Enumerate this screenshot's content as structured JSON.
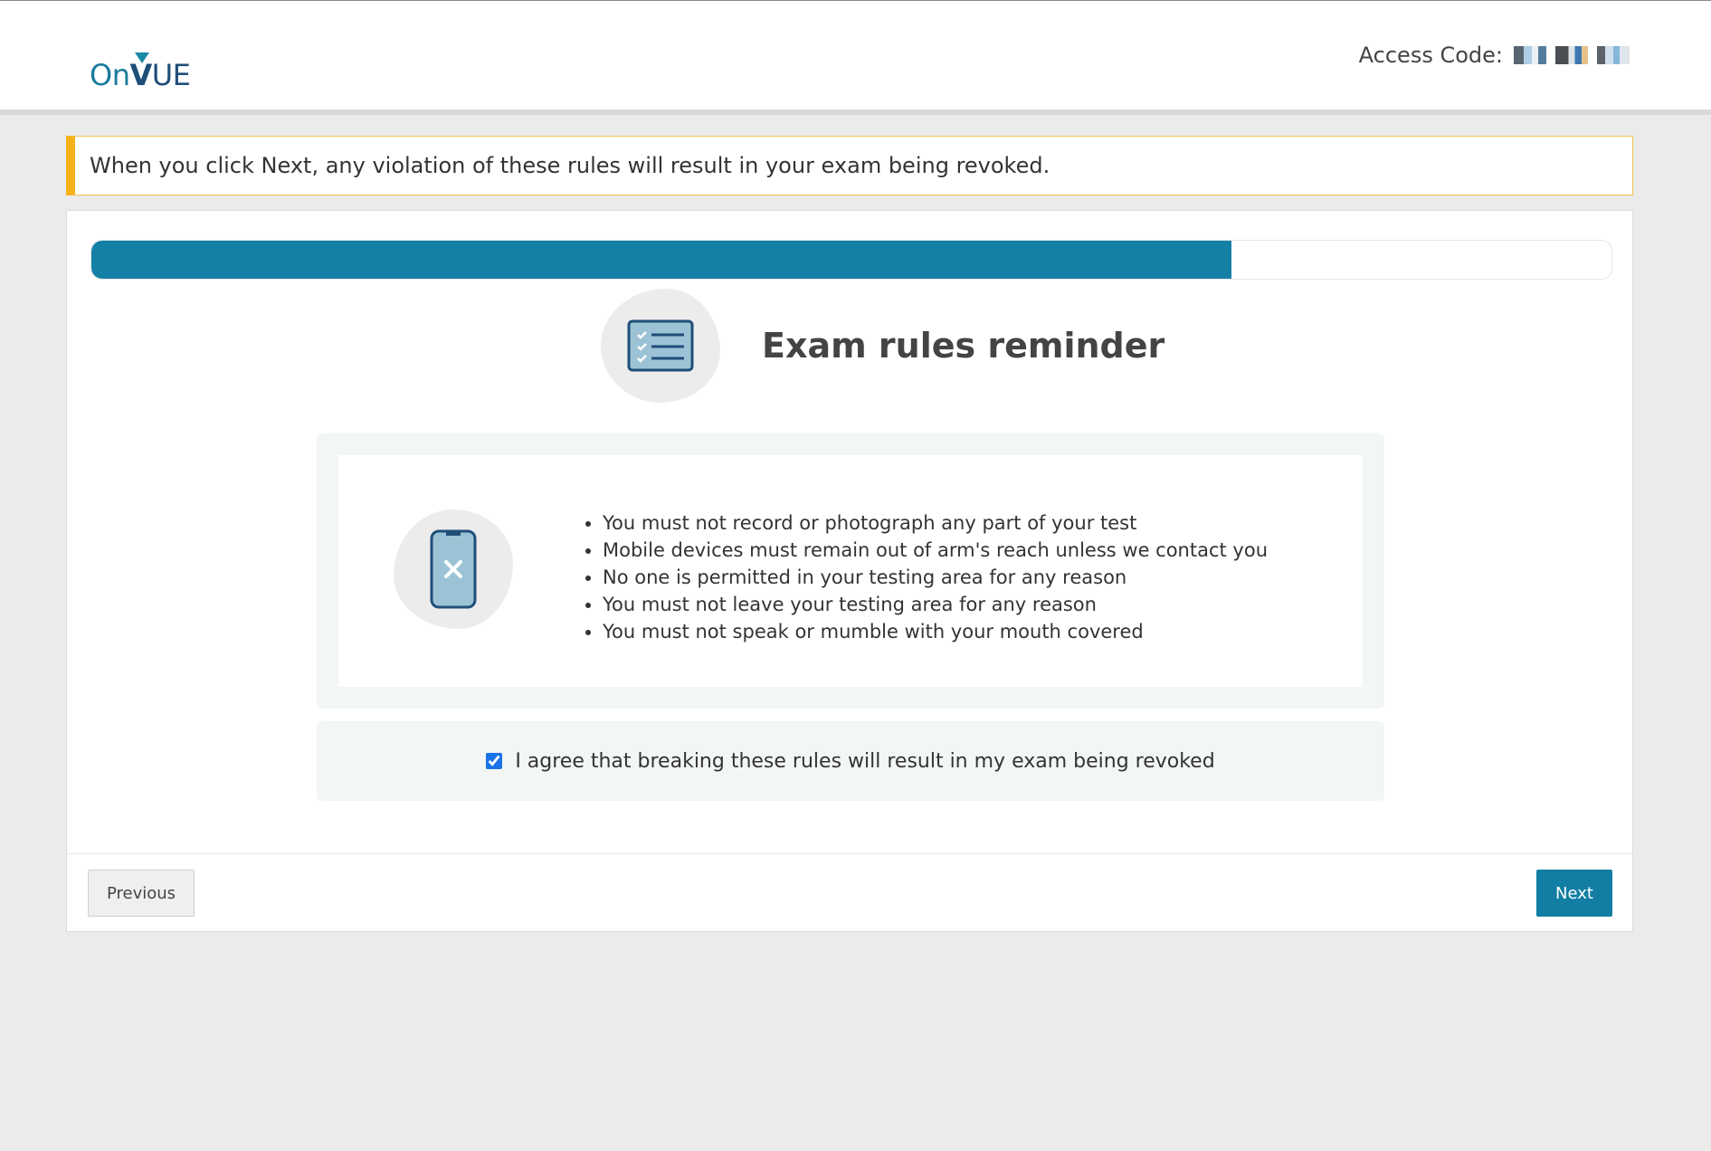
{
  "header": {
    "logo": {
      "on": "On",
      "v": "V",
      "ue": "UE"
    },
    "access_label": "Access Code:"
  },
  "warning": {
    "text": "When you click Next, any violation of these rules will result in your exam being revoked."
  },
  "progress": {
    "value": 0.75
  },
  "main": {
    "title": "Exam rules reminder",
    "rules": [
      "You must not record or photograph any part of your test",
      "Mobile devices must remain out of arm's reach unless we contact you",
      "No one is permitted in your testing area for any reason",
      "You must not leave your testing area for any reason",
      "You must not speak or mumble with your mouth covered"
    ],
    "agree_label": "I agree that breaking these rules will result in my exam being revoked",
    "agree_checked": true
  },
  "footer": {
    "previous_label": "Previous",
    "next_label": "Next"
  },
  "colors": {
    "accent": "#137ea3",
    "warning_border": "#f5b21a"
  }
}
